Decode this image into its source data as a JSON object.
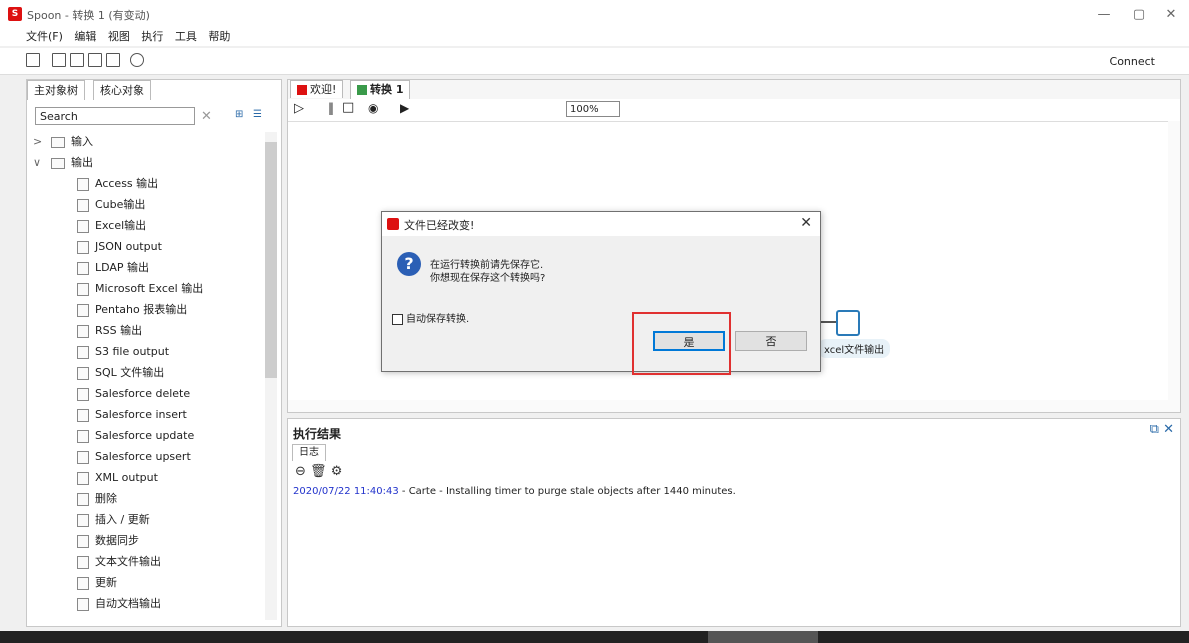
{
  "window": {
    "title": "Spoon - 转换 1 (有变动)",
    "min_glyph": "—",
    "max_glyph": "▢",
    "close_glyph": "✕"
  },
  "menu": [
    "文件(F)",
    "编辑",
    "视图",
    "执行",
    "工具",
    "帮助"
  ],
  "toolbar": {
    "connect_label": "Connect"
  },
  "left_panel": {
    "tabs": [
      "主对象树",
      "核心对象"
    ],
    "search_placeholder": "Search",
    "tree": [
      {
        "label": "输入",
        "level": 0,
        "expander": ">"
      },
      {
        "label": "输出",
        "level": 0,
        "expander": "∨"
      },
      {
        "label": "Access 输出",
        "level": 1
      },
      {
        "label": "Cube输出",
        "level": 1
      },
      {
        "label": "Excel输出",
        "level": 1
      },
      {
        "label": "JSON output",
        "level": 1
      },
      {
        "label": "LDAP 输出",
        "level": 1
      },
      {
        "label": "Microsoft Excel 输出",
        "level": 1
      },
      {
        "label": "Pentaho 报表输出",
        "level": 1
      },
      {
        "label": "RSS 输出",
        "level": 1
      },
      {
        "label": "S3 file output",
        "level": 1
      },
      {
        "label": "SQL 文件输出",
        "level": 1
      },
      {
        "label": "Salesforce delete",
        "level": 1
      },
      {
        "label": "Salesforce insert",
        "level": 1
      },
      {
        "label": "Salesforce update",
        "level": 1
      },
      {
        "label": "Salesforce upsert",
        "level": 1
      },
      {
        "label": "XML output",
        "level": 1
      },
      {
        "label": "删除",
        "level": 1
      },
      {
        "label": "插入 / 更新",
        "level": 1
      },
      {
        "label": "数据同步",
        "level": 1
      },
      {
        "label": "文本文件输出",
        "level": 1
      },
      {
        "label": "更新",
        "level": 1
      },
      {
        "label": "自动文档输出",
        "level": 1
      }
    ]
  },
  "canvas": {
    "tabs": [
      "欢迎!",
      "转换 1"
    ],
    "zoom": "100%",
    "step_label": "xcel文件输出"
  },
  "results": {
    "title": "执行结果",
    "log_tab": "日志",
    "log_timestamp": "2020/07/22 11:40:43",
    "log_message": " - Carte - Installing timer to purge stale objects after 1440 minutes."
  },
  "dialog": {
    "title": "文件已经改变!",
    "message_line1": "在运行转换前请先保存它.",
    "message_line2": "你想现在保存这个转换吗?",
    "checkbox_label": "自动保存转换.",
    "yes_label": "是",
    "no_label": "否"
  }
}
